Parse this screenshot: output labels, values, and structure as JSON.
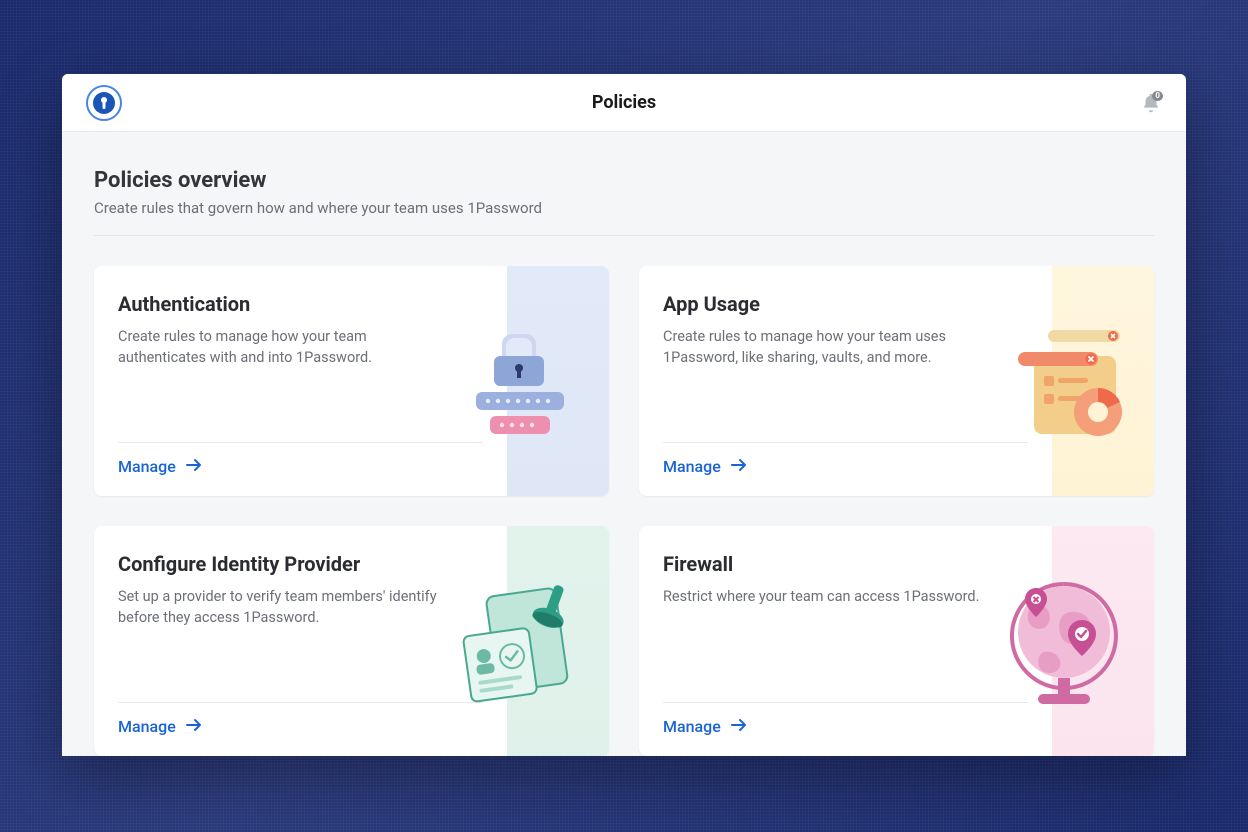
{
  "header": {
    "title": "Policies",
    "notification_count": "0"
  },
  "overview": {
    "title": "Policies overview",
    "subtitle": "Create rules that govern how and where your team uses 1Password"
  },
  "cards": [
    {
      "title": "Authentication",
      "description": "Create rules to manage how your team authenticates with and into 1Password.",
      "cta": "Manage"
    },
    {
      "title": "App Usage",
      "description": "Create rules to manage how your team uses 1Password, like sharing, vaults, and more.",
      "cta": "Manage"
    },
    {
      "title": "Configure Identity Provider",
      "description": "Set up a provider to verify team members' identify before they access 1Password.",
      "cta": "Manage"
    },
    {
      "title": "Firewall",
      "description": "Restrict where your team can access 1Password.",
      "cta": "Manage"
    }
  ]
}
